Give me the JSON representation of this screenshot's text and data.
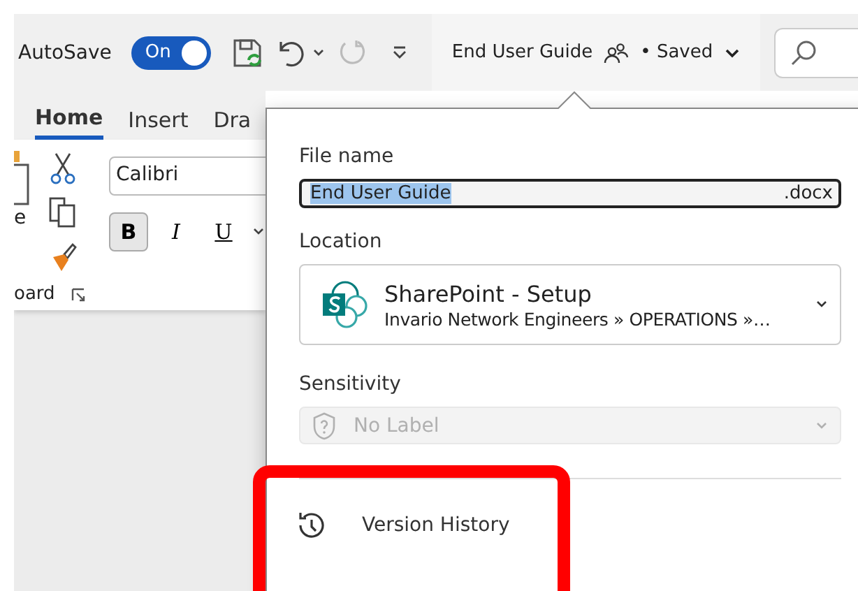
{
  "title_bar": {
    "autosave_label": "AutoSave",
    "autosave": {
      "label": "On",
      "on": true
    },
    "document_title": "End User Guide",
    "save_status": "• Saved"
  },
  "ribbon": {
    "tabs": [
      {
        "label": "Home",
        "selected": true
      },
      {
        "label": "Insert",
        "selected": false
      },
      {
        "label": "Dra",
        "selected": false
      }
    ],
    "paste_label": "e",
    "font_name": "Calibri",
    "format_buttons": [
      {
        "label": "B",
        "pressed": true
      },
      {
        "label": "I",
        "pressed": false
      },
      {
        "label": "U",
        "pressed": false
      }
    ],
    "group_label": "oard"
  },
  "file_panel": {
    "file_name_label": "File name",
    "file_name": "End User Guide",
    "extension": ".docx",
    "location_label": "Location",
    "location": {
      "name": "SharePoint - Setup",
      "path": "Invario Network Engineers » OPERATIONS »…"
    },
    "sensitivity_label": "Sensitivity",
    "sensitivity": {
      "value": "No Label",
      "disabled": true
    },
    "menu_items": [
      {
        "label": "Version History",
        "highlighted": true
      }
    ]
  }
}
